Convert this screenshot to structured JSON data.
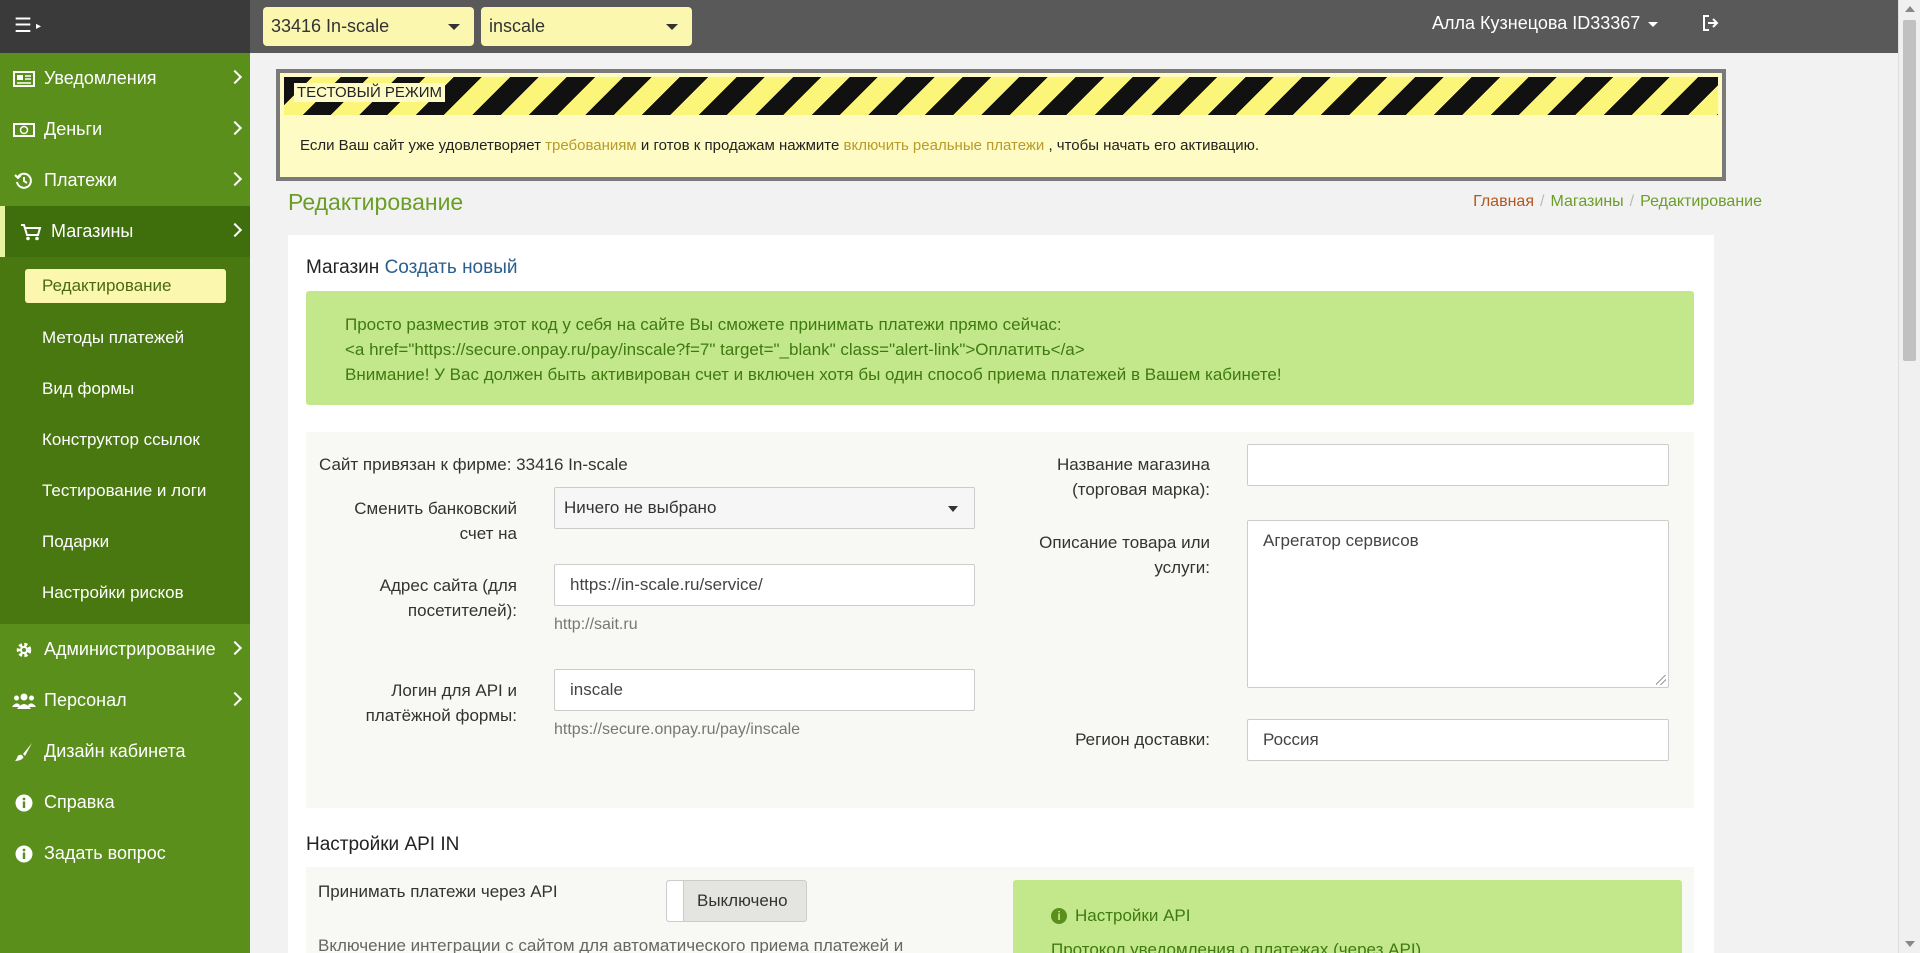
{
  "topbar": {
    "firm_select": "33416 In-scale",
    "shop_select": "inscale",
    "user": "Алла Кузнецова ID33367"
  },
  "sidebar": {
    "items": [
      {
        "label": "Уведомления",
        "icon": "newspaper-icon"
      },
      {
        "label": "Деньги",
        "icon": "money-icon"
      },
      {
        "label": "Платежи",
        "icon": "history-icon"
      },
      {
        "label": "Магазины",
        "icon": "cart-icon"
      }
    ],
    "sub_items": [
      "Редактирование",
      "Методы платежей",
      "Вид формы",
      "Конструктор ссылок",
      "Тестирование и логи",
      "Подарки",
      "Настройки рисков"
    ],
    "items_bottom": [
      {
        "label": "Администрирование",
        "icon": "gear-icon"
      },
      {
        "label": "Персонал",
        "icon": "users-icon"
      },
      {
        "label": "Дизайн кабинета",
        "icon": "brush-icon"
      },
      {
        "label": "Справка",
        "icon": "info-icon"
      },
      {
        "label": "Задать вопрос",
        "icon": "info-icon"
      }
    ]
  },
  "banner": {
    "label": "ТЕСТОВЫЙ РЕЖИМ",
    "text_before": "Если Ваш сайт уже удовлетворяет",
    "link1": "требованиям",
    "text_mid": "и готов к продажам нажмите",
    "link2": "включить реальные платежи",
    "text_after": ", чтобы начать его активацию."
  },
  "page": {
    "title": "Редактирование",
    "breadcrumb": [
      "Главная",
      "Магазины",
      "Редактирование"
    ]
  },
  "shop": {
    "heading": "Магазин",
    "create_link": "Создать новый",
    "alert_lines": [
      "Просто разместив этот код у себя на сайте Вы сможете принимать платежи прямо сейчас:",
      "<a href=\"https://secure.onpay.ru/pay/inscale?f=7\" target=\"_blank\" class=\"alert-link\">Оплатить</a>",
      "Внимание! У Вас должен быть активирован счет и включен хотя бы один способ приема платежей в Вашем кабинете!"
    ]
  },
  "form": {
    "firm_line": "Сайт привязан к фирме: 33416 In-scale",
    "bank_label_1": "Сменить банковский",
    "bank_label_2": "счет на",
    "bank_value": "Ничего не выбрано",
    "site_label_1": "Адрес сайта (для",
    "site_label_2": "посетителей):",
    "site_value": "https://in-scale.ru/service/",
    "site_hint": "http://sait.ru",
    "login_label_1": "Логин для API и",
    "login_label_2": "платёжной формы:",
    "login_value": "inscale",
    "login_hint": "https://secure.onpay.ru/pay/inscale",
    "name_label_1": "Название магазина",
    "name_label_2": "(торговая марка):",
    "name_value": "",
    "desc_label_1": "Описание товара или",
    "desc_label_2": "услуги:",
    "desc_value": "Агрегатор сервисов",
    "region_label": "Регион доставки:",
    "region_value": "Россия"
  },
  "api": {
    "section_title": "Настройки API IN",
    "accept_label": "Принимать платежи через API",
    "toggle_state": "Выключено",
    "info_title": "Настройки API",
    "info_sub": "Протокол уведомления о платежах (через API)",
    "desc": "Включение интеграции с сайтом для автоматического приема платежей и"
  },
  "colors": {
    "sidebar": "#5a8f1b",
    "accent_green": "#6b9e28",
    "alert_green": "#c3e88c",
    "highlight_yellow": "#fbf7ae",
    "topbar": "#595959"
  }
}
